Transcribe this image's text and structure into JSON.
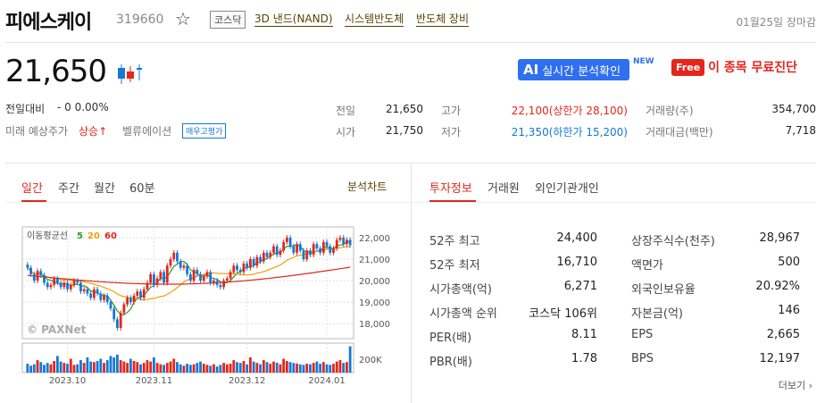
{
  "header": {
    "stock_name": "피에스케이",
    "stock_code": "319660",
    "star_icon": "star-outline-icon",
    "market_badge": "코스닥",
    "themes": [
      "3D 낸드(NAND)",
      "시스템반도체",
      "반도체 장비"
    ],
    "date_status": "01월25일 장마감"
  },
  "price": {
    "current": "21,650",
    "change_label": "전일대비",
    "change_value": "- 0 0.00%",
    "forecast_label": "미래 예상주가",
    "forecast_value": "상승",
    "forecast_arrow": "↑",
    "valuation_label": "벨류에이션",
    "valuation_badge": "매우고평가"
  },
  "promo": {
    "ai_text": "AI",
    "ai_label": "실시간 분석확인",
    "new_tag": "NEW",
    "free_text": "Free",
    "free_label": "이 종목 무료진단"
  },
  "quote": {
    "prev_label": "전일",
    "prev_value": "21,650",
    "high_label": "고가",
    "high_value": "22,100(상한가 28,100)",
    "volume_label": "거래량(주)",
    "volume_value": "354,700",
    "open_label": "시가",
    "open_value": "21,750",
    "low_label": "저가",
    "low_value": "21,350(하한가 15,200)",
    "amount_label": "거래대금(백만)",
    "amount_value": "7,718"
  },
  "chart_tabs": {
    "tabs": [
      "일간",
      "주간",
      "월간",
      "60분"
    ],
    "active": "일간",
    "analysis_link": "분석차트"
  },
  "info_tabs": {
    "tabs": [
      "투자정보",
      "거래원",
      "외인기관개인"
    ],
    "active": "투자정보"
  },
  "info": {
    "left": [
      {
        "label": "52주 최고",
        "value": "24,400"
      },
      {
        "label": "52주 최저",
        "value": "16,710"
      },
      {
        "label": "시가총액(억)",
        "value": "6,271"
      },
      {
        "label": "시가총액 순위",
        "value": "코스닥 106위"
      },
      {
        "label": "PER(배)",
        "value": "8.11"
      },
      {
        "label": "PBR(배)",
        "value": "1.78"
      }
    ],
    "right": [
      {
        "label": "상장주식수(천주)",
        "value": "28,967"
      },
      {
        "label": "액면가",
        "value": "500"
      },
      {
        "label": "외국인보유율",
        "value": "20.92%"
      },
      {
        "label": "자본금(억)",
        "value": "146"
      },
      {
        "label": "EPS",
        "value": "2,665"
      },
      {
        "label": "BPS",
        "value": "12,197"
      }
    ],
    "more_link": "더보기",
    "more_icon": "chevron-right-icon"
  },
  "chart_data": {
    "type": "candlestick",
    "legend_label": "이동평균선",
    "ma_periods": [
      "5",
      "20",
      "60"
    ],
    "ma_colors": [
      "#2e9b2e",
      "#f0a000",
      "#e4261b"
    ],
    "watermark": "© PAXNet",
    "y_ticks": [
      "22,000",
      "21,000",
      "20,000",
      "19,000",
      "18,000"
    ],
    "y_values": [
      22000,
      21000,
      20000,
      19000,
      18000
    ],
    "ylim": [
      17300,
      22500
    ],
    "volume_tick": "200K",
    "x_ticks": [
      "2023.10",
      "2023.11",
      "2023.12",
      "2024.01"
    ],
    "up_color": "#e4261b",
    "down_color": "#1478d6",
    "closes": [
      20600,
      20300,
      20000,
      20450,
      20250,
      19900,
      19700,
      19800,
      20100,
      19900,
      19700,
      19900,
      19600,
      19800,
      20000,
      19900,
      19500,
      19600,
      19400,
      19200,
      19600,
      19400,
      19100,
      19300,
      19000,
      18700,
      18200,
      17800,
      18500,
      18900,
      19200,
      19000,
      19300,
      19500,
      19200,
      19600,
      19900,
      20300,
      19800,
      20100,
      20400,
      19900,
      20700,
      21000,
      21300,
      20900,
      20600,
      20700,
      20300,
      20000,
      20500,
      20300,
      20000,
      20200,
      20400,
      19900,
      20000,
      19800,
      19700,
      20000,
      20100,
      20400,
      20700,
      20500,
      20400,
      20800,
      20600,
      21000,
      20700,
      21100,
      20900,
      21300,
      21100,
      21300,
      21600,
      21200,
      21400,
      21800,
      22000,
      21600,
      21300,
      21700,
      21400,
      21000,
      21400,
      21200,
      21700,
      21500,
      21300,
      21800,
      21600,
      21300,
      21500,
      21900,
      22000,
      21700,
      21900,
      21650
    ],
    "volumes": [
      0.32,
      0.25,
      0.3,
      0.45,
      0.38,
      0.28,
      0.35,
      0.3,
      0.42,
      0.6,
      0.4,
      0.35,
      0.32,
      0.5,
      0.28,
      0.3,
      0.45,
      0.35,
      0.55,
      0.4,
      0.38,
      0.42,
      0.5,
      0.35,
      0.45,
      0.6,
      0.55,
      0.65,
      0.45,
      0.4,
      0.35,
      0.5,
      0.42,
      0.38,
      0.3,
      0.35,
      0.45,
      0.4,
      0.55,
      0.35,
      0.3,
      0.28,
      0.35,
      0.4,
      0.5,
      0.38,
      0.3,
      0.25,
      0.32,
      0.28,
      0.3,
      0.35,
      0.4,
      0.32,
      0.28,
      0.25,
      0.3,
      0.22,
      0.28,
      0.35,
      0.3,
      0.32,
      0.45,
      0.38,
      0.35,
      0.42,
      0.3,
      0.55,
      0.4,
      0.35,
      0.3,
      0.45,
      0.38,
      0.32,
      0.4,
      0.36,
      0.3,
      0.5,
      0.42,
      0.38,
      0.35,
      0.33,
      0.3,
      0.28,
      0.32,
      0.3,
      0.35,
      0.4,
      0.32,
      0.38,
      0.3,
      0.28,
      0.32,
      0.4,
      0.45,
      0.35,
      0.38,
      0.95
    ]
  }
}
